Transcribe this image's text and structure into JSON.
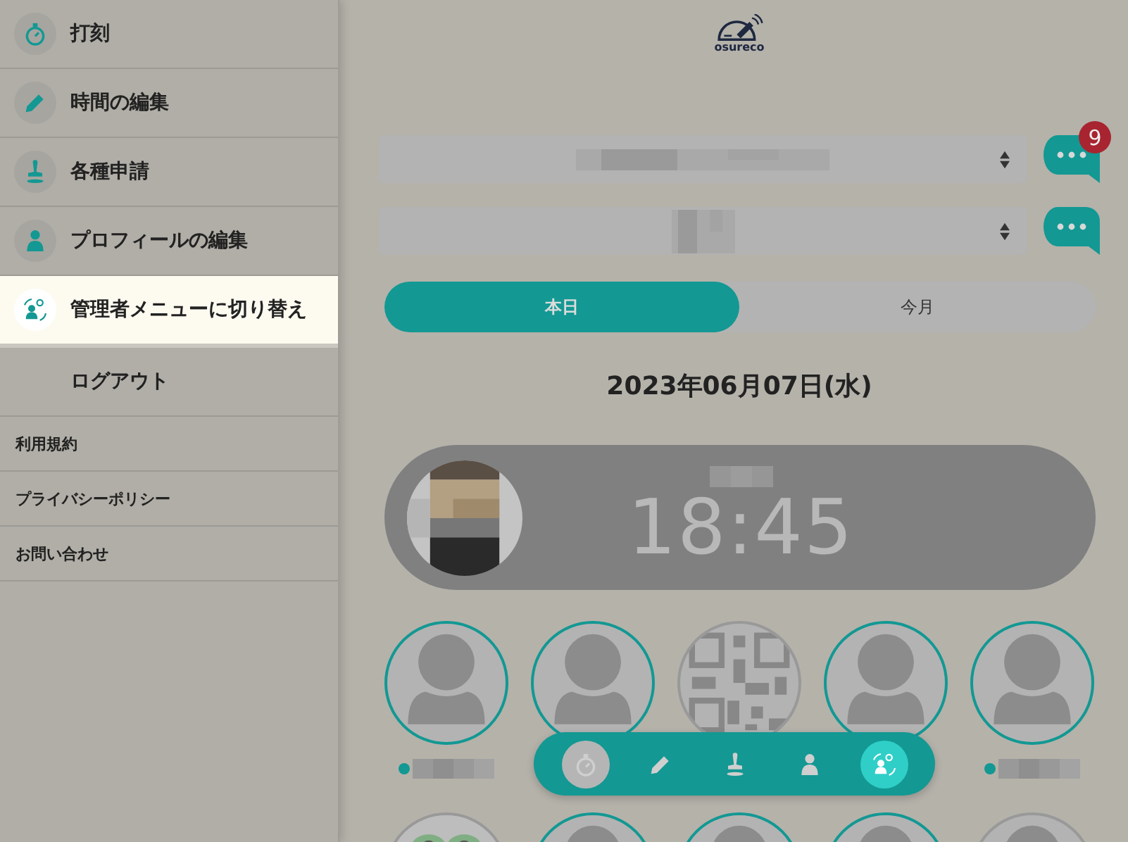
{
  "sidebar": {
    "menu": [
      {
        "label": "打刻",
        "kind": "stopwatch",
        "selected": false
      },
      {
        "label": "時間の編集",
        "kind": "pencil",
        "selected": false
      },
      {
        "label": "各種申請",
        "kind": "stamp",
        "selected": false
      },
      {
        "label": "プロフィールの編集",
        "kind": "person",
        "selected": false
      },
      {
        "label": "管理者メニューに切り替え",
        "kind": "admin",
        "selected": true
      },
      {
        "label": "ログアウト",
        "kind": "plain",
        "selected": false
      }
    ],
    "links": [
      "利用規約",
      "プライバシーポリシー",
      "お問い合わせ"
    ]
  },
  "logo": {
    "text": "osureco"
  },
  "selects": [
    {
      "kind": "with_badge",
      "badge": "9"
    },
    {
      "kind": "plain"
    }
  ],
  "tabs": [
    {
      "label": "本日",
      "selected": true
    },
    {
      "label": "今月",
      "selected": false
    }
  ],
  "date": "2023年06月07日(水)",
  "clock": {
    "time": "18:45"
  },
  "members": [
    {
      "kind": "person",
      "color": "#139893",
      "status_dot": true
    },
    {
      "kind": "person",
      "color": "#139893",
      "status_dot": false
    },
    {
      "kind": "qr",
      "color": "#999999",
      "status_dot": false
    },
    {
      "kind": "person",
      "color": "#139893",
      "status_dot": false
    },
    {
      "kind": "person",
      "color": "#139893",
      "status_dot": true
    },
    {
      "kind": "picture",
      "color": "#999999",
      "status_dot": false
    },
    {
      "kind": "person",
      "color": "#139893",
      "status_dot": false
    },
    {
      "kind": "person",
      "color": "#139893",
      "status_dot": false
    },
    {
      "kind": "person",
      "color": "#139893",
      "status_dot": false
    },
    {
      "kind": "person",
      "color": "#999999",
      "status_dot": false
    }
  ],
  "bottom_nav": [
    {
      "kind": "stopwatch",
      "selected": false
    },
    {
      "kind": "pencil",
      "selected": false
    },
    {
      "kind": "stamp",
      "selected": false
    },
    {
      "kind": "person",
      "selected": false
    },
    {
      "kind": "admin",
      "selected": true
    }
  ]
}
